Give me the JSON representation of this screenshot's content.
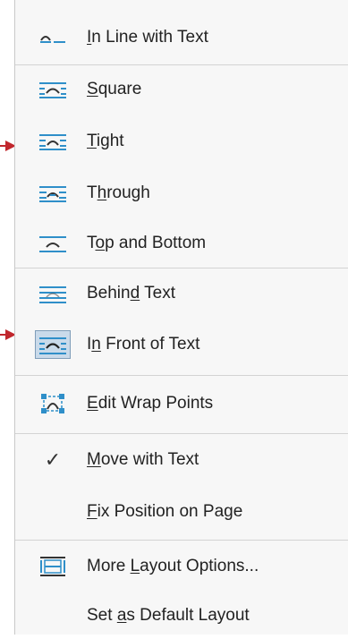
{
  "menu": {
    "items": [
      {
        "label": "In Line with Text",
        "icon": "inline-text-icon",
        "mnemonic": "I"
      },
      {
        "label": "Square",
        "icon": "square-wrap-icon",
        "mnemonic": "S"
      },
      {
        "label": "Tight",
        "icon": "tight-wrap-icon",
        "mnemonic": "T"
      },
      {
        "label": "Through",
        "icon": "through-wrap-icon",
        "mnemonic": "h"
      },
      {
        "label": "Top and Bottom",
        "icon": "top-bottom-wrap-icon",
        "mnemonic": "o"
      },
      {
        "label": "Behind Text",
        "icon": "behind-text-icon",
        "mnemonic": "d"
      },
      {
        "label": "In Front of Text",
        "icon": "in-front-text-icon",
        "mnemonic": "n"
      },
      {
        "label": "Edit Wrap Points",
        "icon": "edit-wrap-points-icon",
        "mnemonic": "E"
      },
      {
        "label": "Move with Text",
        "icon": "checkmark-icon",
        "mnemonic": "M"
      },
      {
        "label": "Fix Position on Page",
        "icon": "",
        "mnemonic": "F"
      },
      {
        "label": "More Layout Options...",
        "icon": "layout-options-icon",
        "mnemonic": "L"
      },
      {
        "label": "Set as Default Layout",
        "icon": "",
        "mnemonic": "a"
      }
    ],
    "checkmark": "✓"
  },
  "colors": {
    "accent": "#2f8fc9",
    "arrow": "#c1272d",
    "highlight": "#c9daea"
  }
}
